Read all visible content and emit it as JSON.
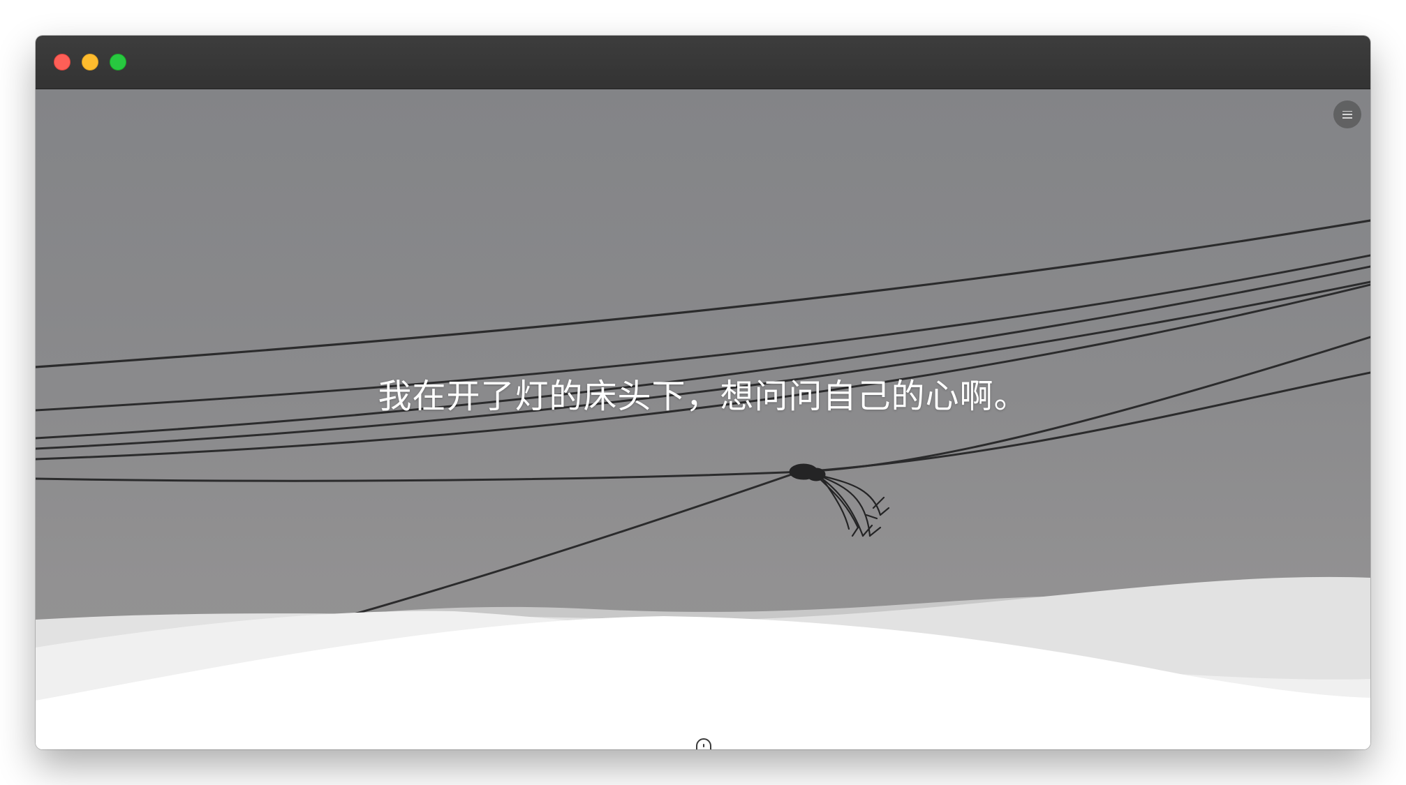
{
  "window": {
    "controls": [
      "close",
      "minimize",
      "maximize"
    ]
  },
  "hero": {
    "quote": "我在开了灯的床头下，想问问自己的心啊。",
    "background_description_icons": [
      "power-lines",
      "knot"
    ]
  },
  "nav": {
    "menu_icon": "hamburger-icon"
  },
  "scroll_hint": {
    "icon": "mouse-icon"
  },
  "colors": {
    "titlebar": "#353535",
    "sky": "#898a8c",
    "close": "#fe5f57",
    "minimize": "#febc2e",
    "maximize": "#28c840",
    "wave_light": "#e0e0e0",
    "wave_white": "#ffffff"
  }
}
